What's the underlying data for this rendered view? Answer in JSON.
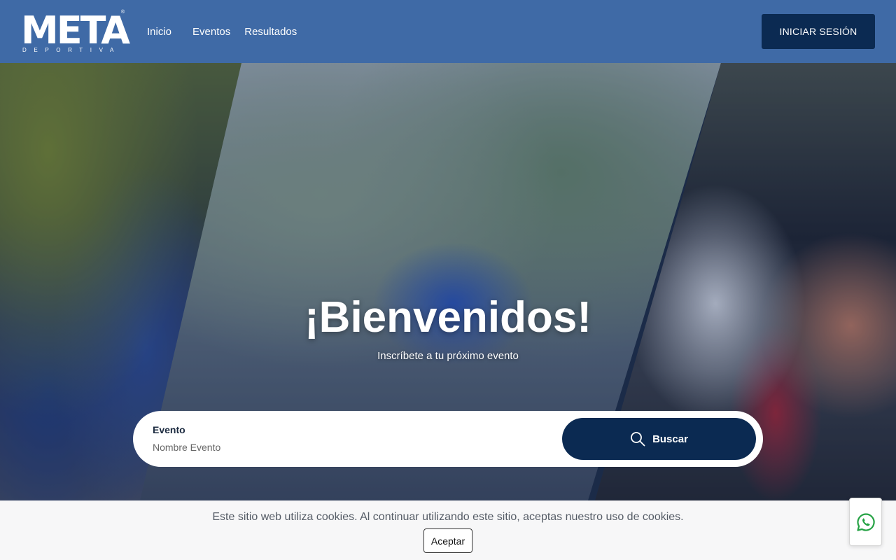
{
  "header": {
    "logo_text": "META",
    "logo_sub": "DEPORTIVA",
    "logo_reg": "®",
    "nav": [
      {
        "label": "Inicio"
      },
      {
        "label": "Eventos"
      },
      {
        "label": "Resultados"
      }
    ],
    "login_label": "INICIAR SESIÓN"
  },
  "hero": {
    "title": "¡Bienvenidos!",
    "subtitle": "Inscríbete a tu próximo evento",
    "search": {
      "label": "Evento",
      "placeholder": "Nombre Evento",
      "value": "",
      "button_label": "Buscar",
      "button_icon": "search-icon"
    }
  },
  "cookie": {
    "text": "Este sitio web utiliza cookies. Al continuar utilizando este sitio, aceptas nuestro uso de cookies.",
    "accept_label": "Aceptar"
  },
  "whatsapp": {
    "icon": "whatsapp-icon"
  },
  "colors": {
    "header_bg": "#3f6aa6",
    "primary_dark": "#0b2a52",
    "cookie_bg": "#f7f7f8",
    "whatsapp_green": "#25a244"
  }
}
